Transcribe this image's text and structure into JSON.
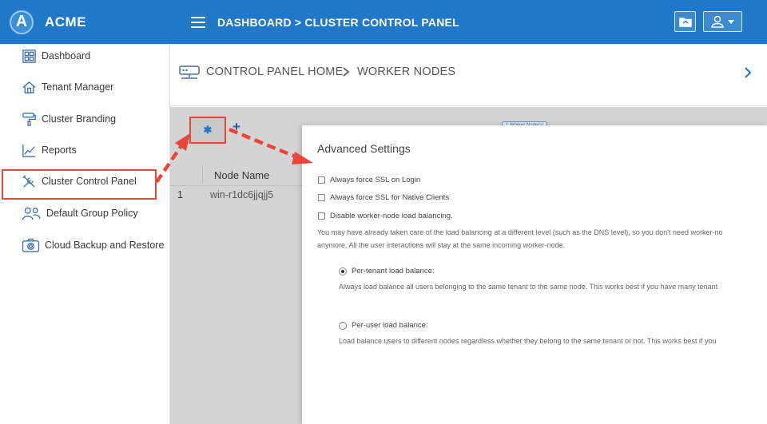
{
  "brand": {
    "logo_letter": "A",
    "name": "ACME"
  },
  "sidebar": {
    "items": [
      {
        "label": "Dashboard",
        "icon": "dashboard-grid-icon"
      },
      {
        "label": "Tenant Manager",
        "icon": "house-icon"
      },
      {
        "label": "Cluster Branding",
        "icon": "paint-roller-icon"
      },
      {
        "label": "Reports",
        "icon": "line-chart-icon"
      },
      {
        "label": "Cluster Control Panel",
        "icon": "tools-icon"
      },
      {
        "label": "Default Group Policy",
        "icon": "users-icon"
      },
      {
        "label": "Cloud Backup and Restore",
        "icon": "camera-backup-icon"
      }
    ],
    "active_item": "Cluster Control Panel"
  },
  "header": {
    "title": "DASHBOARD > CLUSTER CONTROL PANEL",
    "folder_button_icon": "folder-icon",
    "user_menu_icon": "user-icon"
  },
  "breadcrumb": {
    "icon": "server-icon",
    "home": "CONTROL PANEL HOME",
    "separator_icon": "chevron-right-icon",
    "current": "WORKER NODES"
  },
  "toolbar": {
    "settings_icon": "gear-icon",
    "settings_glyph": "✱",
    "add_glyph": "+",
    "add_icon": "plus-icon",
    "badge_text": "1 Worker Node(s)"
  },
  "table": {
    "header": "Node Name",
    "rows": [
      {
        "index": "1",
        "name": "win-r1dc6jjqjj5"
      }
    ]
  },
  "dialog": {
    "title": "Advanced Settings",
    "checkboxes": [
      {
        "label": "Always force SSL on Login",
        "checked": false
      },
      {
        "label": "Always force SSL for Native Clients",
        "checked": false
      },
      {
        "label": "Disable worker-node load balancing.",
        "checked": false
      }
    ],
    "note_line1": "You may have already taken care of the load balancing at a different level (such as the DNS level), so you don't need worker-no",
    "note_line2": "anymore. All the user interactions will stay at the same incoming worker-node.",
    "options": [
      {
        "label": "Per-tenant load balance:",
        "selected": true,
        "description": "Always load balance all users belonging to the same tenant to the same node. This works best if you have many tenant"
      },
      {
        "label": "Per-user load balance:",
        "selected": false,
        "description": "Load balance users to different nodes regardless whether they belong to the same tenant or not. This works best if you"
      }
    ]
  },
  "colors": {
    "primary": "#1f78c8",
    "annotation_red": "#e8463a",
    "content_gray": "#d4d4d4"
  }
}
